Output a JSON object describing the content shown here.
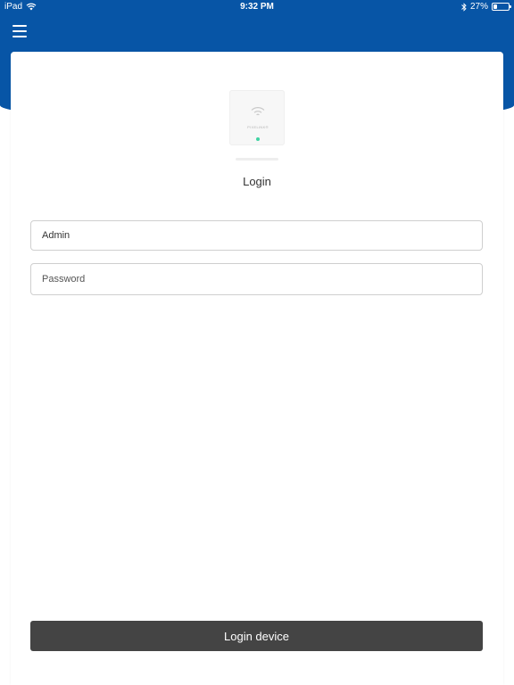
{
  "status_bar": {
    "device": "iPad",
    "time": "9:32 PM",
    "battery": "27%",
    "battery_level": 0.27
  },
  "header": {
    "menu_icon": "hamburger-menu-icon",
    "color": "#0755a6"
  },
  "device_image": {
    "brand": "PIXELINK®",
    "led_color": "#3fd3a2"
  },
  "login": {
    "title": "Login",
    "username_value": "Admin",
    "password_placeholder": "Password",
    "submit_label": "Login device"
  },
  "colors": {
    "accent": "#0755a6",
    "button": "#444444"
  }
}
